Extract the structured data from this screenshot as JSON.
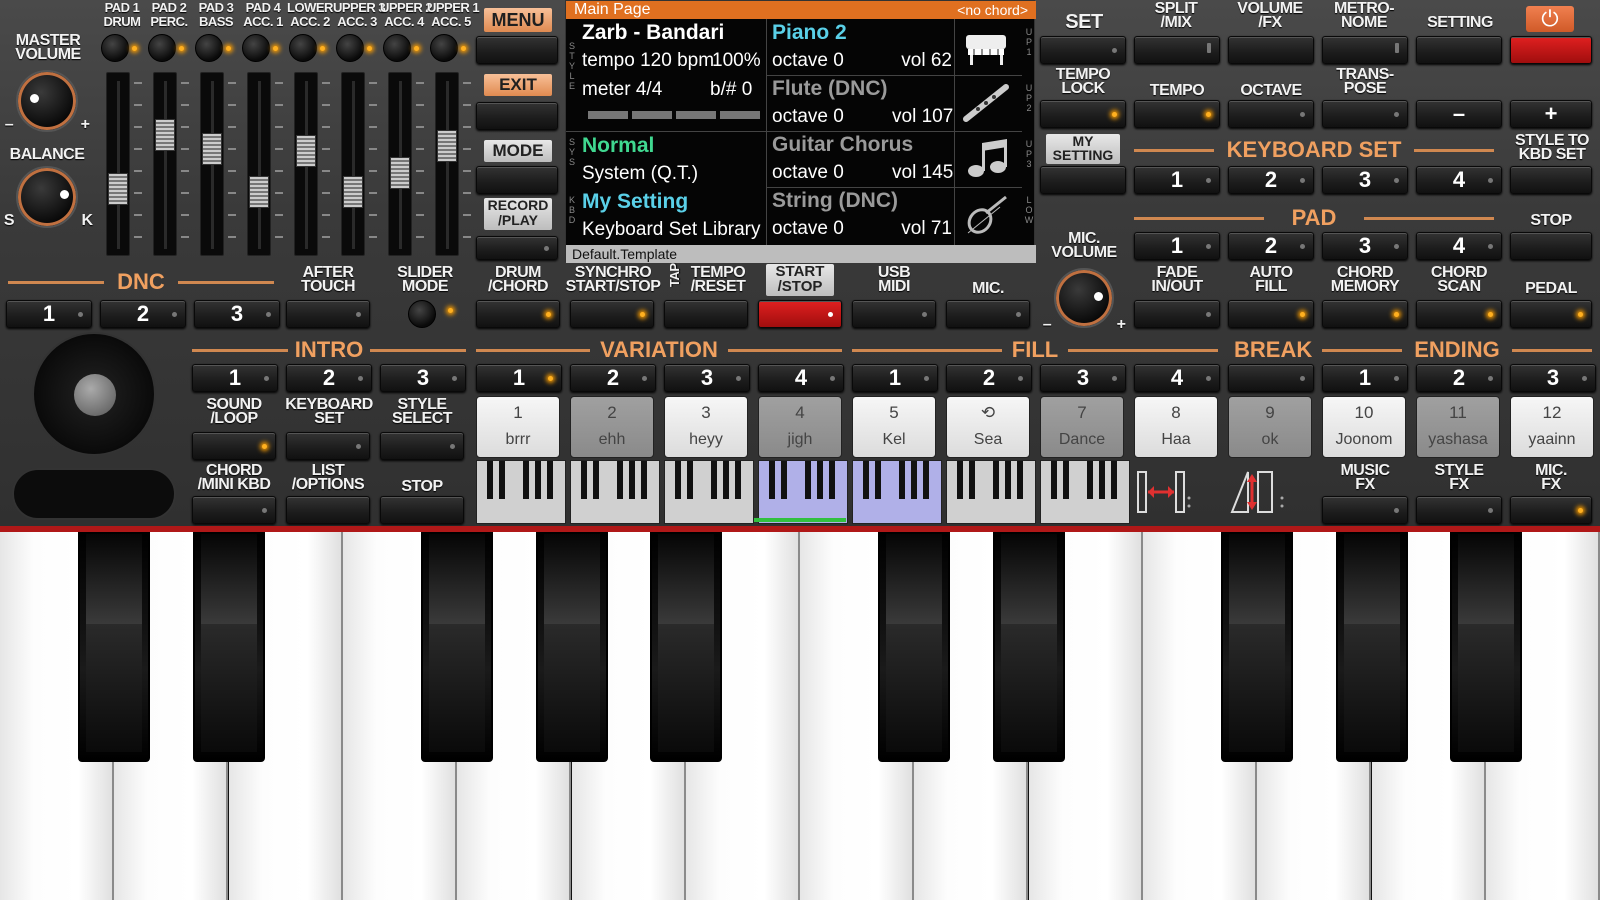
{
  "header": {
    "master_volume": "MASTER\nVOLUME",
    "balance": "BALANCE",
    "balance_left": "S",
    "balance_right": "K",
    "vol_minus": "–",
    "vol_plus": "+",
    "channels": [
      {
        "top": "PAD 1",
        "bottom": "DRUM"
      },
      {
        "top": "PAD 2",
        "bottom": "PERC."
      },
      {
        "top": "PAD 3",
        "bottom": "BASS"
      },
      {
        "top": "PAD 4",
        "bottom": "ACC. 1"
      },
      {
        "top": "LOWER",
        "bottom": "ACC. 2"
      },
      {
        "top": "UPPER 3",
        "bottom": "ACC. 3"
      },
      {
        "top": "UPPER 2",
        "bottom": "ACC. 4"
      },
      {
        "top": "UPPER 1",
        "bottom": "ACC. 5"
      }
    ],
    "slider_levels": [
      0.32,
      0.72,
      0.62,
      0.3,
      0.6,
      0.3,
      0.44,
      0.64
    ],
    "menu": "MENU",
    "exit": "EXIT",
    "mode": "MODE",
    "record_play": "RECORD\n/PLAY"
  },
  "display": {
    "title": "Main Page",
    "chord": "<no chord>",
    "style_name": "Zarb - Bandari",
    "tempo": "tempo 120 bpm",
    "tempo_pct": "100%",
    "meter": "meter 4/4",
    "bsharp": "b/# 0",
    "mode_name": "Normal",
    "system": "System (Q.T.)",
    "kbd_set": "My Setting",
    "kbd_library": "Keyboard Set Library",
    "template": "Default.Template",
    "parts": [
      {
        "name": "Piano 2",
        "octave": "octave  0",
        "vol": "vol 62",
        "icon": "piano-icon",
        "tag": "UP1"
      },
      {
        "name": "Flute (DNC)",
        "octave": "octave  0",
        "vol": "vol 107",
        "icon": "flute-icon",
        "tag": "UP2"
      },
      {
        "name": "Guitar Chorus",
        "octave": "octave  0",
        "vol": "vol 145",
        "icon": "note-icon",
        "tag": "UP3"
      },
      {
        "name": "String (DNC)",
        "octave": "octave  0",
        "vol": "vol 71",
        "icon": "violin-icon",
        "tag": "LOW"
      }
    ],
    "left_tags": [
      "STYLE",
      "SYS",
      "KBD"
    ]
  },
  "right": {
    "set": "SET",
    "split_mix": "SPLIT\n/MIX",
    "volume_fx": "VOLUME\n/FX",
    "metronome": "METRO-\nNOME",
    "setting": "SETTING",
    "power_icon": "⏻",
    "tempo_lock": "TEMPO\nLOCK",
    "tempo": "TEMPO",
    "octave": "OCTAVE",
    "transpose": "TRANS-\nPOSE",
    "minus": "–",
    "plus": "+",
    "my_setting": "MY\nSETTING",
    "keyboard_set": "KEYBOARD SET",
    "style_to_kbd": "STYLE TO\nKBD SET",
    "pad": "PAD",
    "stop": "STOP",
    "nums": [
      "1",
      "2",
      "3",
      "4"
    ]
  },
  "row2": {
    "dnc": "DNC",
    "dnc_nums": [
      "1",
      "2",
      "3"
    ],
    "after_touch": "AFTER\nTOUCH",
    "slider_mode": "SLIDER\nMODE",
    "drum_chord": "DRUM\n/CHORD",
    "synchro": "SYNCHRO\nSTART/STOP",
    "tap": "TAP",
    "tempo_reset": "TEMPO\n/RESET",
    "start_stop": "START\n/STOP",
    "usb_midi": "USB\nMIDI",
    "mic": "MIC.",
    "mic_volume": "MIC.\nVOLUME",
    "fade": "FADE\nIN/OUT",
    "auto_fill": "AUTO\nFILL",
    "chord_memory": "CHORD\nMEMORY",
    "chord_scan": "CHORD\nSCAN",
    "pedal": "PEDAL"
  },
  "row3": {
    "intro": "INTRO",
    "variation": "VARIATION",
    "fill": "FILL",
    "break": "BREAK",
    "ending": "ENDING",
    "intro_nums": [
      "1",
      "2",
      "3"
    ],
    "var_nums": [
      "1",
      "2",
      "3",
      "4"
    ],
    "fill_nums": [
      "1",
      "2",
      "3",
      "4"
    ],
    "end_nums": [
      "1",
      "2",
      "3"
    ]
  },
  "row4": {
    "sound_loop": "SOUND\n/LOOP",
    "keyboard_set": "KEYBOARD\nSET",
    "style_select": "STYLE\nSELECT",
    "chord_mini": "CHORD\n/MINI KBD",
    "list_options": "LIST\n/OPTIONS",
    "stop": "STOP",
    "music_fx": "MUSIC\nFX",
    "style_fx": "STYLE\nFX",
    "mic_fx": "MIC.\nFX"
  },
  "pads": [
    {
      "num": "1",
      "name": "brrr"
    },
    {
      "num": "2",
      "name": "ehh"
    },
    {
      "num": "3",
      "name": "heyy"
    },
    {
      "num": "4",
      "name": "jigh"
    },
    {
      "num": "5",
      "name": "Kel"
    },
    {
      "num": "6",
      "name": "Sea"
    },
    {
      "num": "7",
      "name": "Dance"
    },
    {
      "num": "8",
      "name": "Haa"
    },
    {
      "num": "9",
      "name": "ok"
    },
    {
      "num": "10",
      "name": "Joonom"
    },
    {
      "num": "11",
      "name": "yashasa"
    },
    {
      "num": "12",
      "name": "yaainn"
    }
  ],
  "colors": {
    "accent_orange": "#e07020",
    "section_label": "#f0a060",
    "led_on": "#ffb020",
    "start_red": "#d01818",
    "cyan_text": "#5ad0e8",
    "green_text": "#40d890"
  }
}
